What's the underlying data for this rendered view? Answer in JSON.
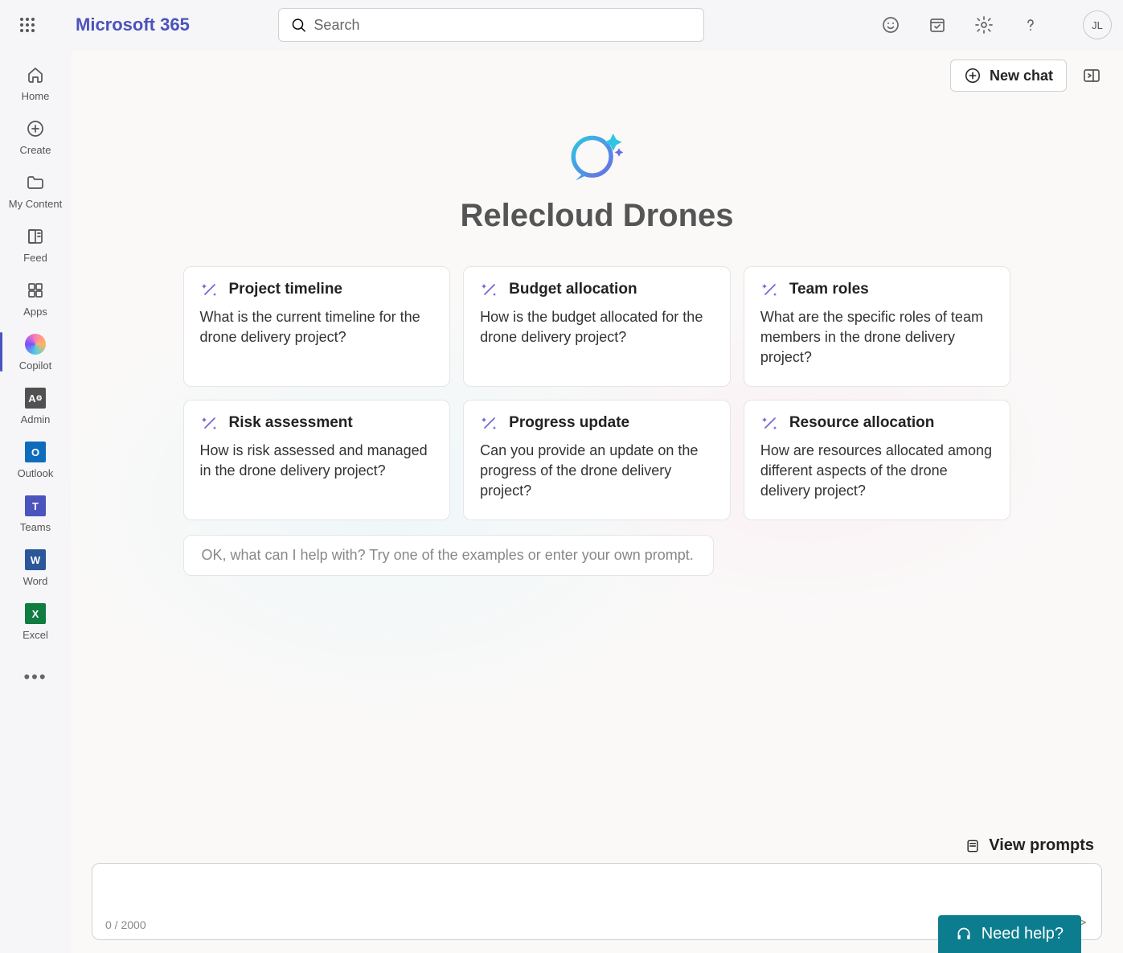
{
  "header": {
    "brand": "Microsoft 365",
    "search_placeholder": "Search",
    "avatar_initials": "JL"
  },
  "sidebar": {
    "items": [
      {
        "label": "Home"
      },
      {
        "label": "Create"
      },
      {
        "label": "My Content"
      },
      {
        "label": "Feed"
      },
      {
        "label": "Apps"
      },
      {
        "label": "Copilot"
      },
      {
        "label": "Admin"
      },
      {
        "label": "Outlook"
      },
      {
        "label": "Teams"
      },
      {
        "label": "Word"
      },
      {
        "label": "Excel"
      }
    ]
  },
  "top_actions": {
    "new_chat": "New chat"
  },
  "hero": {
    "title": "Relecloud Drones"
  },
  "cards": [
    {
      "title": "Project timeline",
      "body": "What is the current timeline for the drone delivery project?"
    },
    {
      "title": "Budget allocation",
      "body": "How is the budget allocated for the drone delivery project?"
    },
    {
      "title": "Team roles",
      "body": "What are the specific roles of team members in the drone delivery project?"
    },
    {
      "title": "Risk assessment",
      "body": "How is risk assessed and managed in the drone delivery project?"
    },
    {
      "title": "Progress update",
      "body": "Can you provide an update on the progress of the drone delivery project?"
    },
    {
      "title": "Resource allocation",
      "body": "How are resources allocated among different aspects of the drone delivery project?"
    }
  ],
  "hint": "OK, what can I help with? Try one of the examples or enter your own prompt.",
  "bottom": {
    "view_prompts": "View prompts",
    "char_count": "0 / 2000",
    "need_help": "Need help?"
  }
}
